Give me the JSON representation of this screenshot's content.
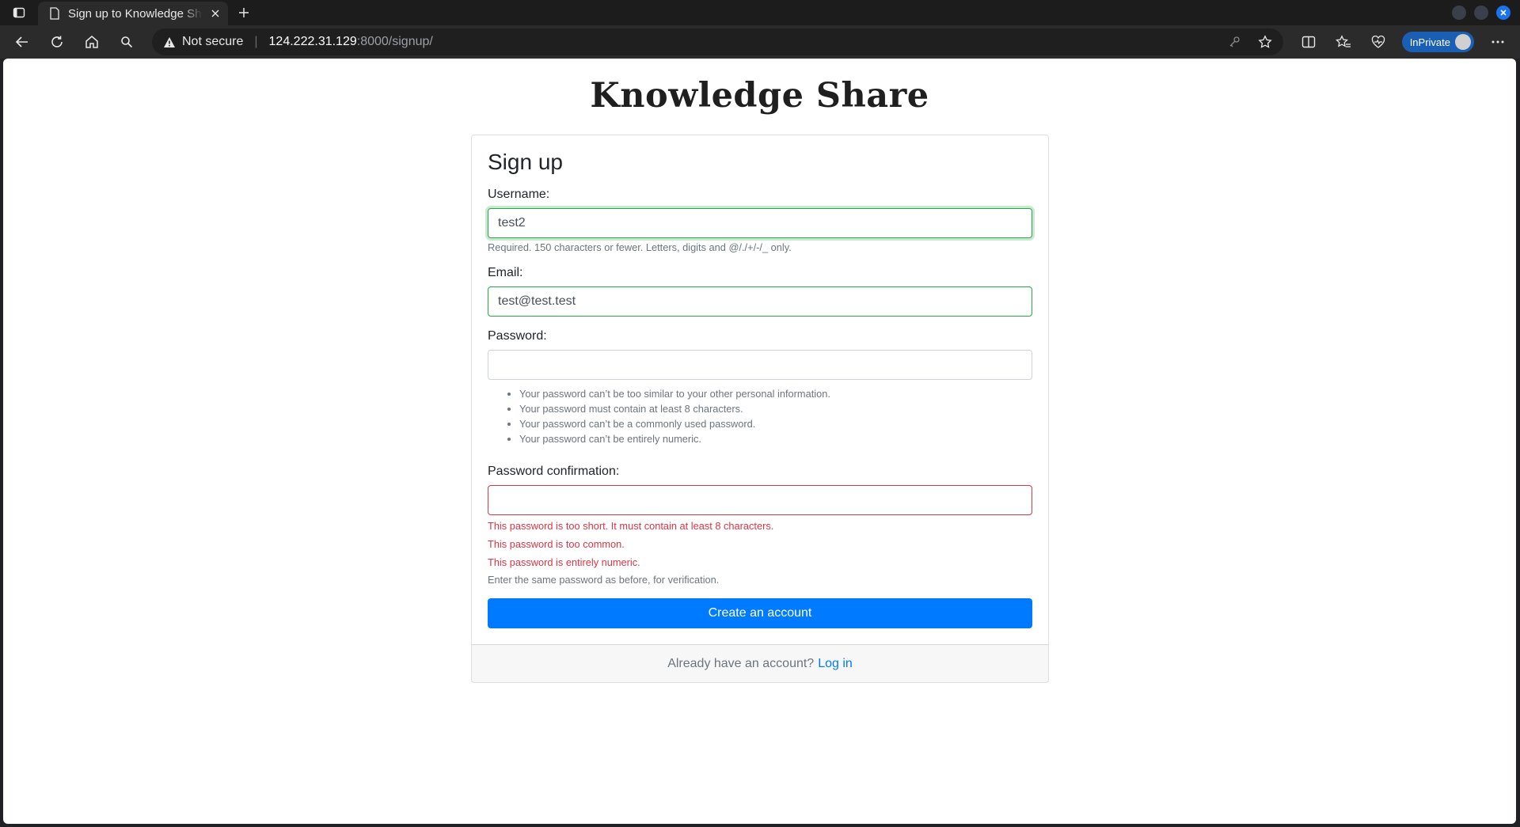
{
  "browser": {
    "tab_title": "Sign up to Knowledge Share",
    "security_label": "Not secure",
    "url_host": "124.222.31.129",
    "url_path": ":8000/signup/",
    "inprivate_label": "InPrivate"
  },
  "page": {
    "site_title": "Knowledge Share",
    "heading": "Sign up",
    "username": {
      "label": "Username:",
      "value": "test2",
      "help": "Required. 150 characters or fewer. Letters, digits and @/./+/-/_ only."
    },
    "email": {
      "label": "Email:",
      "value": "test@test.test"
    },
    "password": {
      "label": "Password:",
      "value": "",
      "help_items": [
        "Your password can’t be too similar to your other personal information.",
        "Your password must contain at least 8 characters.",
        "Your password can’t be a commonly used password.",
        "Your password can’t be entirely numeric."
      ]
    },
    "password_confirmation": {
      "label": "Password confirmation:",
      "value": "",
      "errors": [
        "This password is too short. It must contain at least 8 characters.",
        "This password is too common.",
        "This password is entirely numeric."
      ],
      "help": "Enter the same password as before, for verification."
    },
    "submit_label": "Create an account",
    "footer_text": "Already have an account?",
    "login_link": "Log in"
  },
  "colors": {
    "primary": "#007bff",
    "valid": "#28a745",
    "invalid": "#dc3545"
  }
}
